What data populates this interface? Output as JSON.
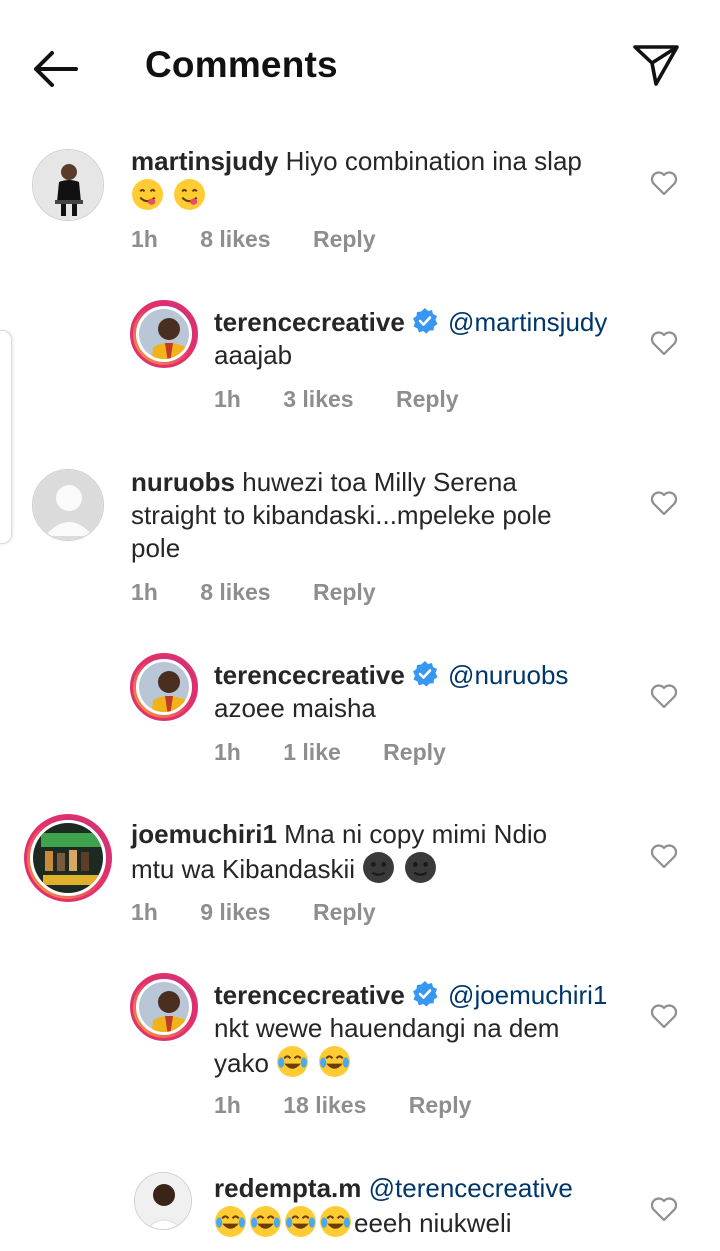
{
  "header": {
    "title": "Comments"
  },
  "comments": [
    {
      "user": "martinsjudy",
      "mention": "",
      "text": "Hiyo combination ina slap",
      "emojis": "😋😋",
      "time": "1h",
      "likes": "8 likes",
      "reply": "Reply"
    },
    {
      "user": "terencecreative",
      "mention": "@martinsjudy",
      "text": "aaajab",
      "emojis": "",
      "time": "1h",
      "likes": "3 likes",
      "reply": "Reply"
    },
    {
      "user": "nuruobs",
      "mention": "",
      "text_line1": "huwezi toa Milly Serena",
      "text_line2": "straight to kibandaski...mpeleke pole",
      "text_line3": "pole",
      "time": "1h",
      "likes": "8 likes",
      "reply": "Reply"
    },
    {
      "user": "terencecreative",
      "mention": "@nuruobs",
      "text": "azoee maisha",
      "emojis": "",
      "time": "1h",
      "likes": "1 like",
      "reply": "Reply"
    },
    {
      "user": "joemuchiri1",
      "mention": "",
      "text": "Mna ni copy mimi Ndio",
      "text_line2": "mtu wa Kibandaskii",
      "emojis": "🌚🌚",
      "time": "1h",
      "likes": "9 likes",
      "reply": "Reply"
    },
    {
      "user": "terencecreative",
      "mention": "@joemuchiri1",
      "text": "nkt wewe hauendangi na dem",
      "text_line2": "yako",
      "emojis": "😂😂",
      "time": "1h",
      "likes": "18 likes",
      "reply": "Reply"
    },
    {
      "user": "redempta.m",
      "mention": "@terencecreative",
      "text": "eeeh niukweli",
      "emojis": "😂😂😂😂",
      "time": "",
      "likes": "",
      "reply": ""
    }
  ]
}
